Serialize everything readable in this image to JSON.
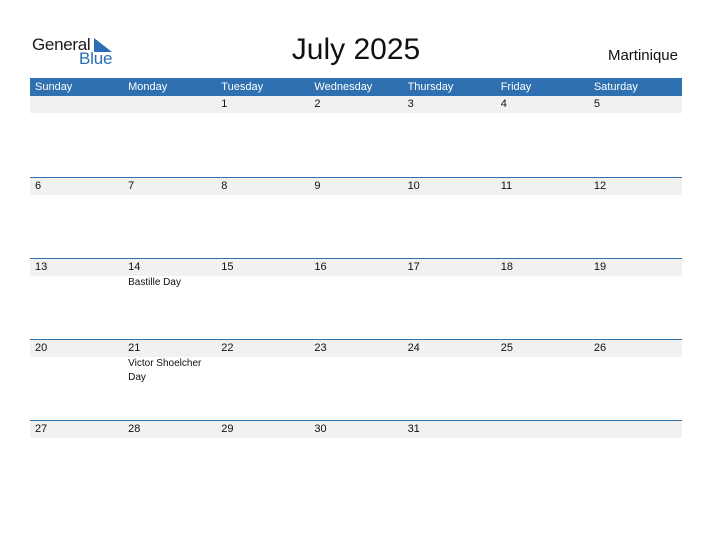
{
  "logo": {
    "general": "General",
    "blue": "Blue",
    "brand_color": "#2a6fb5"
  },
  "title": "July 2025",
  "region": "Martinique",
  "header_color": "#2e70b0",
  "days": [
    "Sunday",
    "Monday",
    "Tuesday",
    "Wednesday",
    "Thursday",
    "Friday",
    "Saturday"
  ],
  "weeks": [
    [
      {
        "d": ""
      },
      {
        "d": ""
      },
      {
        "d": "1"
      },
      {
        "d": "2"
      },
      {
        "d": "3"
      },
      {
        "d": "4"
      },
      {
        "d": "5"
      }
    ],
    [
      {
        "d": "6"
      },
      {
        "d": "7"
      },
      {
        "d": "8"
      },
      {
        "d": "9"
      },
      {
        "d": "10"
      },
      {
        "d": "11"
      },
      {
        "d": "12"
      }
    ],
    [
      {
        "d": "13"
      },
      {
        "d": "14",
        "e": "Bastille Day"
      },
      {
        "d": "15"
      },
      {
        "d": "16"
      },
      {
        "d": "17"
      },
      {
        "d": "18"
      },
      {
        "d": "19"
      }
    ],
    [
      {
        "d": "20"
      },
      {
        "d": "21",
        "e": "Victor Shoelcher Day"
      },
      {
        "d": "22"
      },
      {
        "d": "23"
      },
      {
        "d": "24"
      },
      {
        "d": "25"
      },
      {
        "d": "26"
      }
    ],
    [
      {
        "d": "27"
      },
      {
        "d": "28"
      },
      {
        "d": "29"
      },
      {
        "d": "30"
      },
      {
        "d": "31"
      },
      {
        "d": ""
      },
      {
        "d": ""
      }
    ]
  ]
}
